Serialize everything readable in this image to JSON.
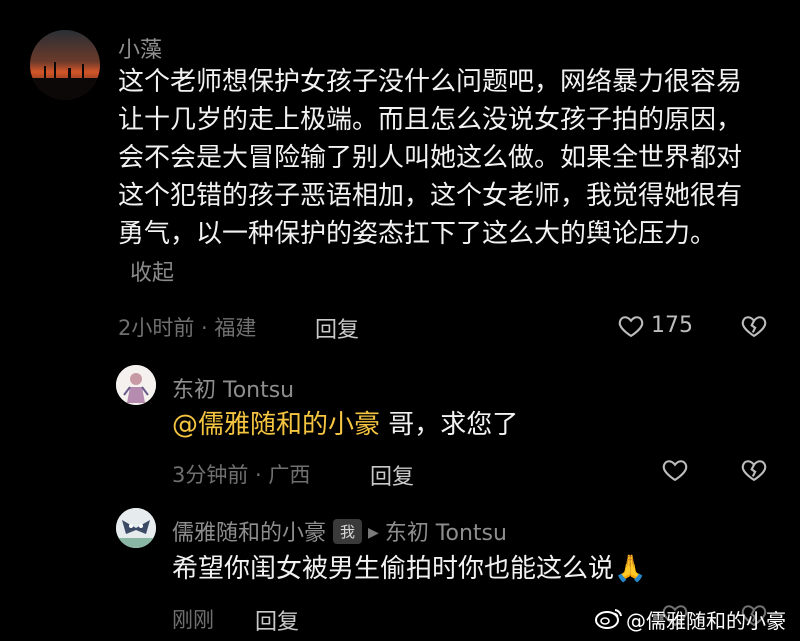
{
  "comment": {
    "author": "小藻",
    "text": "这个老师想保护女孩子没什么问题吧，网络暴力很容易让十几岁的走上极端。而且怎么没说女孩子拍的原因，会不会是大冒险输了别人叫她这么做。如果全世界都对这个犯错的孩子恶语相加，这个女老师，我觉得她很有勇气，以一种保护的姿态扛下了这么大的舆论压力。",
    "collapse_label": "收起",
    "meta": "2小时前 · 福建",
    "reply_label": "回复",
    "likes": "175"
  },
  "reply1": {
    "author": "东初 Tontsu",
    "mention": "@儒雅随和的小豪",
    "text": " 哥，求您了",
    "meta": "3分钟前 · 广西",
    "reply_label": "回复"
  },
  "reply2": {
    "author": "儒雅随和的小豪",
    "badge": "我",
    "target": "东初 Tontsu",
    "text": "希望你闺女被男生偷拍时你也能这么说",
    "emoji": "🙏",
    "meta": "刚刚",
    "reply_label": "回复"
  },
  "watermark": "@儒雅随和的小豪",
  "colors": {
    "mention": "#f5c541",
    "background": "#000000"
  }
}
